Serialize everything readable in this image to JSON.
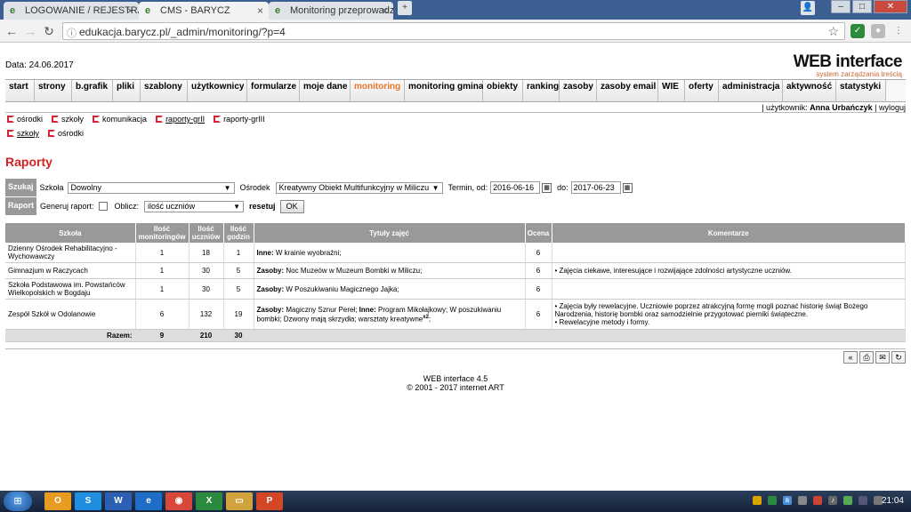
{
  "browser": {
    "tabs": [
      {
        "label": "LOGOWANIE / REJESTRA",
        "active": false
      },
      {
        "label": "CMS - BARYCZ",
        "active": true
      },
      {
        "label": "Monitoring przeprowadz",
        "active": false
      }
    ],
    "url": "edukacja.barycz.pl/_admin/monitoring/?p=4"
  },
  "header": {
    "date": "Data: 24.06.2017",
    "logo_main": "WEB interface",
    "logo_sub": "system zarządzania treścią"
  },
  "menu": [
    {
      "label": "start"
    },
    {
      "label": "strony"
    },
    {
      "label": "b.grafik"
    },
    {
      "label": "pliki"
    },
    {
      "label": "szablony"
    },
    {
      "label": "użytkownicy"
    },
    {
      "label": "formularze"
    },
    {
      "label": "moje dane"
    },
    {
      "label": "monitoring",
      "active": true
    },
    {
      "label": "monitoring gmina"
    },
    {
      "label": "obiekty"
    },
    {
      "label": "rankingi"
    },
    {
      "label": "zasoby"
    },
    {
      "label": "zasoby email"
    },
    {
      "label": "WIE"
    },
    {
      "label": "oferty"
    },
    {
      "label": "administracja"
    },
    {
      "label": "aktywność"
    },
    {
      "label": "statystyki"
    }
  ],
  "userbar": {
    "prefix": "| użytkownik:",
    "name": "Anna Urbańczyk",
    "logout": "| wyloguj"
  },
  "submenu1": [
    "ośrodki",
    "szkoły",
    "komunikacja",
    "raporty-grII",
    "raporty-grIII"
  ],
  "submenu2": [
    "szkoły",
    "ośrodki"
  ],
  "page_title": "Raporty",
  "search": {
    "label": "Szukaj",
    "school_label": "Szkoła",
    "school_value": "Dowolny",
    "center_label": "Ośrodek",
    "center_value": "Kreatywny Obiekt Multifunkcyjny w Miliczu",
    "from_label": "Termin, od:",
    "from_value": "2016-06-16",
    "to_label": "do:",
    "to_value": "2017-06-23"
  },
  "report": {
    "label": "Raport",
    "generate_label": "Generuj raport:",
    "calc_label": "Oblicz:",
    "calc_value": "ilość uczniów",
    "reset_label": "resetuj",
    "ok_label": "OK"
  },
  "table": {
    "headers": [
      "Szkoła",
      "Ilość monitoringów",
      "Ilość uczniów",
      "Ilość godzin",
      "Tytuły zajęć",
      "Ocena",
      "Komentarze"
    ],
    "rows": [
      {
        "school": "Dzienny Ośrodek Rehabilitacyjno - Wychowawczy",
        "monitorings": "1",
        "students": "18",
        "hours": "1",
        "titles_parts": [
          {
            "b": "Inne:"
          },
          {
            "t": " W krainie wyobraźni;"
          }
        ],
        "grade": "6",
        "comments": ""
      },
      {
        "school": "Gimnazjum w Raczycach",
        "monitorings": "1",
        "students": "30",
        "hours": "5",
        "titles_parts": [
          {
            "b": "Zasoby:"
          },
          {
            "t": " Noc Muzeów w Muzeum Bombki w Miliczu;"
          }
        ],
        "grade": "6",
        "comments": "• Zajęcia ciekawe, interesujące i rozwijające zdolności artystyczne uczniów."
      },
      {
        "school": "Szkoła Podstawowa im. Powstańców Wielkopolskich w Bogdaju",
        "monitorings": "1",
        "students": "30",
        "hours": "5",
        "titles_parts": [
          {
            "b": "Zasoby:"
          },
          {
            "t": " W Poszukiwaniu Magicznego Jajka;"
          }
        ],
        "grade": "6",
        "comments": ""
      },
      {
        "school": "Zespół Szkół w Odolanowie",
        "monitorings": "6",
        "students": "132",
        "hours": "19",
        "titles_parts": [
          {
            "b": "Zasoby:"
          },
          {
            "t": " Magiczny Sznur Pereł; "
          },
          {
            "b": "Inne:"
          },
          {
            "t": " Program Mikołajkowy; W poszukiwaniu bombki; Dzwony mają skrzydła; warsztaty kreatywne"
          },
          {
            "sup": "x2"
          },
          {
            "t": ";"
          }
        ],
        "grade": "6",
        "comments": "• Zajęcia były rewelacyjne. Uczniowie poprzez atrakcyjną formę mogli poznać historię świąt Bożego Narodzenia, historię bombki oraz samodzielnie przygotować pierniki świąteczne.\n• Rewelacyjne metody i formy."
      }
    ],
    "total_label": "Razem:",
    "total_monitorings": "9",
    "total_students": "210",
    "total_hours": "30"
  },
  "footer": {
    "line1": "WEB interface 4.5",
    "line2": "© 2001 - 2017 internet ART"
  },
  "taskbar": {
    "clock": "21:04"
  }
}
